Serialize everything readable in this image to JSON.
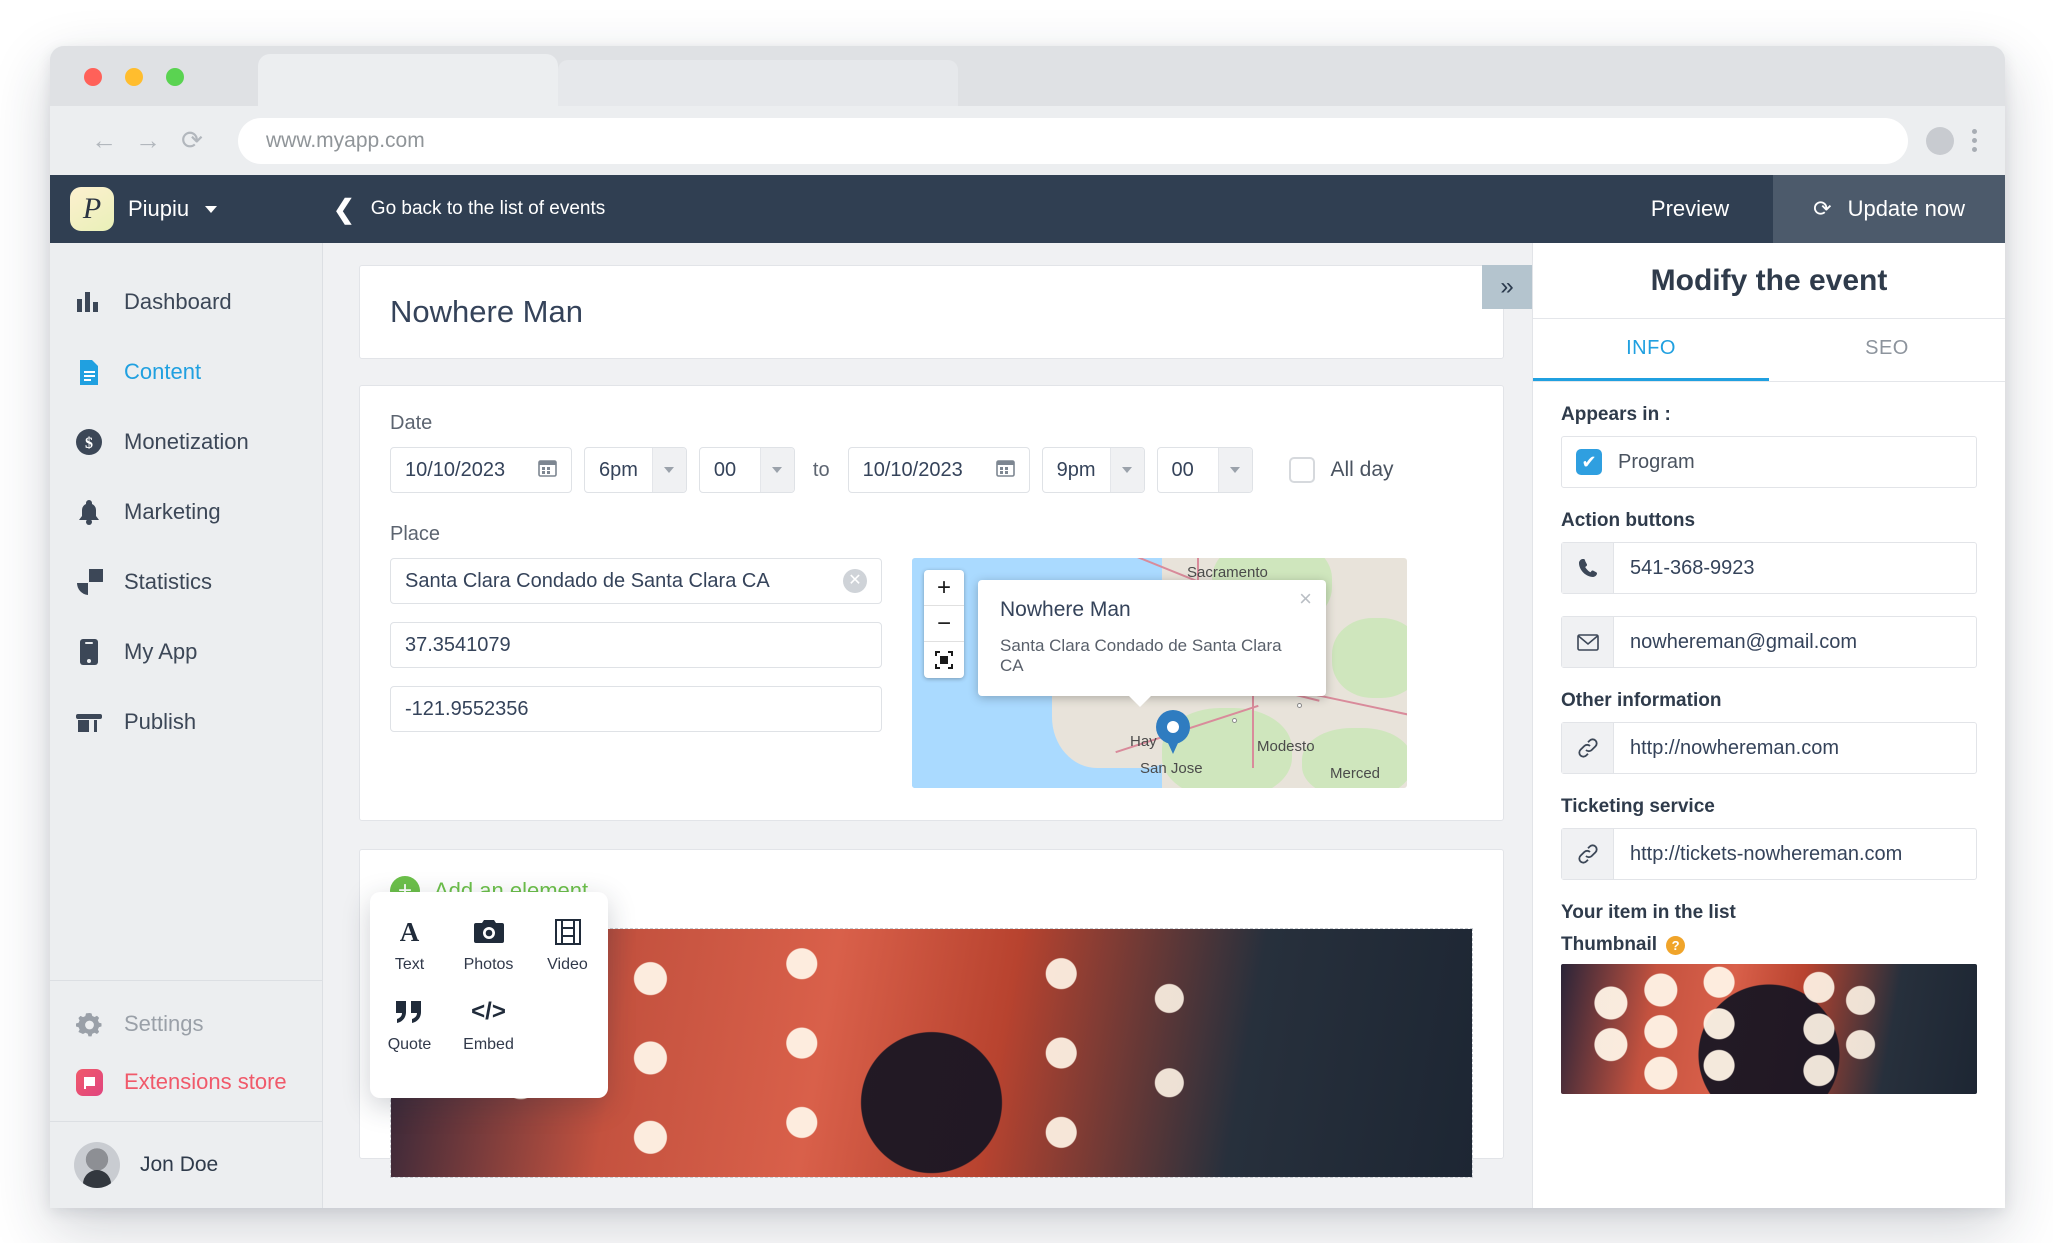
{
  "browser": {
    "url": "www.myapp.com",
    "back_icon": "arrow-left-icon",
    "forward_icon": "arrow-right-icon",
    "reload_icon": "reload-icon",
    "menu_icon": "kebab-menu-icon"
  },
  "topbar": {
    "brand_letter": "P",
    "brand_name": "Piupiu",
    "back_link": "Go back to the list of events",
    "preview_label": "Preview",
    "update_label": "Update now",
    "update_icon": "refresh-icon"
  },
  "sidebar": {
    "items": [
      {
        "label": "Dashboard",
        "icon": "bar-chart-icon",
        "active": false
      },
      {
        "label": "Content",
        "icon": "document-icon",
        "active": true
      },
      {
        "label": "Monetization",
        "icon": "dollar-circle-icon",
        "active": false
      },
      {
        "label": "Marketing",
        "icon": "bell-icon",
        "active": false
      },
      {
        "label": "Statistics",
        "icon": "pie-chart-icon",
        "active": false
      },
      {
        "label": "My App",
        "icon": "phone-icon",
        "active": false
      },
      {
        "label": "Publish",
        "icon": "store-icon",
        "active": false
      }
    ],
    "settings_label": "Settings",
    "settings_icon": "gear-icon",
    "store_label": "Extensions store",
    "store_icon": "extensions-icon",
    "user_name": "Jon Doe"
  },
  "editor": {
    "event_title": "Nowhere Man",
    "date_label": "Date",
    "date_start": "10/10/2023",
    "hour_start": "6pm",
    "minute_start": "00",
    "to_label": "to",
    "date_end": "10/10/2023",
    "hour_end": "9pm",
    "minute_end": "00",
    "allday_label": "All day",
    "allday_checked": false,
    "place_label": "Place",
    "place_value": "Santa Clara Condado de Santa Clara CA",
    "latitude": "37.3541079",
    "longitude": "-121.9552356",
    "add_element_label": "Add an element",
    "element_menu": [
      {
        "label": "Text",
        "icon": "text-icon",
        "glyph": "A"
      },
      {
        "label": "Photos",
        "icon": "camera-icon",
        "glyph": "camera"
      },
      {
        "label": "Video",
        "icon": "film-icon",
        "glyph": "film"
      },
      {
        "label": "Quote",
        "icon": "quote-icon",
        "glyph": "”"
      },
      {
        "label": "Embed",
        "icon": "code-icon",
        "glyph": "</>"
      }
    ]
  },
  "map": {
    "zoom_in": "+",
    "zoom_out": "−",
    "fullscreen_icon": "fullscreen-icon",
    "popup_title": "Nowhere Man",
    "popup_address": "Santa Clara Condado de Santa Clara CA",
    "popup_close": "×",
    "labels": [
      "Sacramento",
      "Hay",
      "Modesto",
      "San Jose",
      "Merced"
    ]
  },
  "panel": {
    "toggle_icon": "chevron-double-right-icon",
    "title": "Modify the event",
    "tabs": [
      {
        "label": "INFO",
        "active": true
      },
      {
        "label": "SEO",
        "active": false
      }
    ],
    "appears_in_label": "Appears in :",
    "appears_in_value": "Program",
    "appears_in_checked": true,
    "action_buttons_label": "Action buttons",
    "phone": "541-368-9923",
    "phone_icon": "phone-handset-icon",
    "email": "nowhereman@gmail.com",
    "email_icon": "envelope-icon",
    "other_info_label": "Other information",
    "website": "http://nowhereman.com",
    "website_icon": "link-icon",
    "ticketing_label": "Ticketing service",
    "ticketing": "http://tickets-nowhereman.com",
    "ticketing_icon": "link-icon",
    "your_item_label": "Your item in the list",
    "thumbnail_label": "Thumbnail",
    "thumbnail_help": "?"
  },
  "colors": {
    "topbar": "#303f52",
    "accent": "#20a0e0",
    "green": "#6cc04a",
    "store_pink": "#f0596a",
    "pin_blue": "#2f7cc0"
  }
}
